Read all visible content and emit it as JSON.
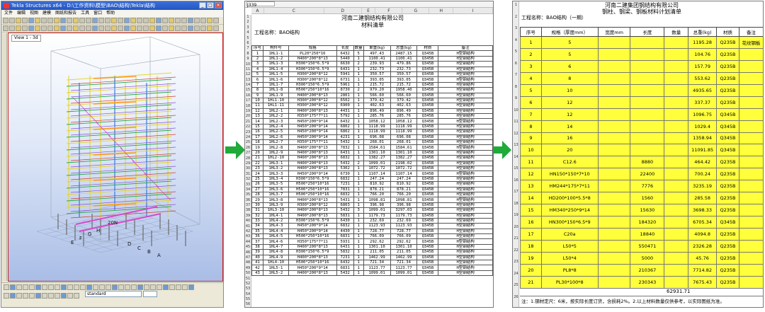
{
  "tekla": {
    "window_title": "Tekla Structures x64 - D:\\工作资料\\模型\\BAO\\结构\\Tekla\\结构",
    "menu": [
      "文件",
      "编辑",
      "视图",
      "建模",
      "图纸和报告",
      "工具",
      "窗口",
      "帮助"
    ],
    "view_label": "View 1 - 3d",
    "grid_labels": [
      "E",
      "F",
      "G",
      "H",
      "20N",
      "D",
      "C",
      "B",
      "A"
    ],
    "status_combo": "standard",
    "colors": {
      "titlebar": "#2456c2",
      "view_border": "#cc2222",
      "members": [
        "#e4d42a",
        "#d33a2a",
        "#2a6fd6",
        "#2aa84a",
        "#8a4fd0",
        "#d64ac8",
        "#ff8c1a"
      ]
    }
  },
  "arrows": {
    "color": "#1faa3a"
  },
  "sheet": {
    "name_box": "J339",
    "columns": [
      "A",
      "C",
      "D",
      "E",
      "F",
      "G",
      "H",
      "I"
    ],
    "title1": "河南二建钢结构有限公司",
    "title2": "材料清单",
    "title3": "工程名称：BAO结构",
    "headers": [
      "序号",
      "构件号",
      "规格",
      "长度",
      "数量",
      "单重(kg)",
      "总重(kg)",
      "材质",
      "备注"
    ],
    "rows": [
      [
        "1",
        "1HL1-1",
        "PL20*250*16",
        "6432",
        "5",
        "497.43",
        "2487.15",
        "Q345B",
        "H型钢结构"
      ],
      [
        "2",
        "1HL1-2",
        "H400*200*8*13",
        "5440",
        "1",
        "1100.41",
        "1100.41",
        "Q345B",
        "H型钢结构"
      ],
      [
        "3",
        "1HL1-3",
        "H300*150*6.5*9",
        "6630",
        "2",
        "239.93",
        "479.86",
        "Q345B",
        "H型钢结构"
      ],
      [
        "4",
        "1HL1-4",
        "H300*150*6.5*9",
        "6431",
        "1",
        "232.73",
        "232.73",
        "Q345B",
        "H型钢结构"
      ],
      [
        "5",
        "1HL1-5",
        "H300*200*8*12",
        "5941",
        "1",
        "350.57",
        "350.57",
        "Q345B",
        "H型钢结构"
      ],
      [
        "6",
        "1HL1-6",
        "H300*200*8*12",
        "6731",
        "1",
        "393.05",
        "393.05",
        "Q345B",
        "H型钢结构"
      ],
      [
        "7",
        "1HL1-7",
        "H300*150*6.5*9",
        "5961",
        "1",
        "215.72",
        "215.72",
        "Q345B",
        "H型钢结构"
      ],
      [
        "8",
        "1HL1-8",
        "H500*250*10*16",
        "8730",
        "2",
        "979.20",
        "1958.40",
        "Q345B",
        "H型钢结构"
      ],
      [
        "9",
        "1HL1-9",
        "H400*200*8*13",
        "2801",
        "1",
        "566.60",
        "566.60",
        "Q345B",
        "H型钢结构"
      ],
      [
        "10",
        "1HL1-10",
        "H300*200*8*12",
        "6502",
        "1",
        "379.42",
        "379.42",
        "Q345B",
        "H型钢结构"
      ],
      [
        "11",
        "1HL1-11",
        "H300*200*8*12",
        "6900",
        "1",
        "402.63",
        "402.63",
        "Q345B",
        "H型钢结构"
      ],
      [
        "12",
        "1HL2-1",
        "H400*200*8*13",
        "4431",
        "1",
        "896.49",
        "896.49",
        "Q345B",
        "H型钢结构"
      ],
      [
        "13",
        "1HL2-2",
        "H350*175*7*11",
        "5792",
        "1",
        "285.76",
        "285.76",
        "Q345B",
        "H型钢结构"
      ],
      [
        "14",
        "1HL2-3",
        "H450*200*9*14",
        "6432",
        "1",
        "1058.12",
        "1058.12",
        "Q345B",
        "H型钢结构"
      ],
      [
        "15",
        "1HL2-4",
        "H450*200*9*14",
        "6802",
        "1",
        "1118.99",
        "1118.99",
        "Q345B",
        "H型钢结构"
      ],
      [
        "16",
        "1HL2-5",
        "H450*200*9*14",
        "6802",
        "1",
        "1118.99",
        "1118.99",
        "Q345B",
        "H型钢结构"
      ],
      [
        "17",
        "1HL2-6",
        "H450*200*9*14",
        "4231",
        "1",
        "696.08",
        "696.08",
        "Q345B",
        "H型钢结构"
      ],
      [
        "18",
        "1HL2-7",
        "H350*175*7*11",
        "5432",
        "1",
        "268.01",
        "268.01",
        "Q345B",
        "H型钢结构"
      ],
      [
        "19",
        "1HL2-8",
        "H400*200*8*13",
        "7832",
        "1",
        "1584.61",
        "1584.61",
        "Q345B",
        "H型钢结构"
      ],
      [
        "20",
        "1HL2-9",
        "H400*200*8*13",
        "6431",
        "1",
        "1301.10",
        "1301.10",
        "Q345B",
        "H型钢结构"
      ],
      [
        "21",
        "1HL2-10",
        "H400*200*8*13",
        "6832",
        "1",
        "1382.27",
        "1382.27",
        "Q345B",
        "H型钢结构"
      ],
      [
        "22",
        "1HL3-1",
        "H400*200*8*13",
        "5432",
        "2",
        "1099.01",
        "2198.02",
        "Q345B",
        "H型钢结构"
      ],
      [
        "23",
        "1HL3-2",
        "H400*200*8*13",
        "5302",
        "1",
        "1072.72",
        "1072.72",
        "Q345B",
        "H型钢结构"
      ],
      [
        "24",
        "1HL3-3",
        "H450*200*9*14",
        "6730",
        "1",
        "1107.14",
        "1107.14",
        "Q345B",
        "H型钢结构"
      ],
      [
        "25",
        "1HL3-4",
        "H300*150*6.5*9",
        "6832",
        "1",
        "247.24",
        "247.24",
        "Q345B",
        "H型钢结构"
      ],
      [
        "26",
        "1HL3-5",
        "H500*250*10*16",
        "7231",
        "1",
        "810.92",
        "810.92",
        "Q345B",
        "H型钢结构"
      ],
      [
        "27",
        "1HL3-6",
        "H500*250*10*16",
        "7831",
        "1",
        "878.21",
        "878.21",
        "Q345B",
        "H型钢结构"
      ],
      [
        "28",
        "1HL3-7",
        "H500*250*10*16",
        "6832",
        "1",
        "766.20",
        "766.20",
        "Q345B",
        "H型钢结构"
      ],
      [
        "29",
        "1HL3-8",
        "H400*200*8*13",
        "5431",
        "1",
        "1098.81",
        "1098.81",
        "Q345B",
        "H型钢结构"
      ],
      [
        "30",
        "1HL3-9",
        "H300*200*8*12",
        "6803",
        "1",
        "396.98",
        "396.98",
        "Q345B",
        "H型钢结构"
      ],
      [
        "31",
        "1HL3-10",
        "H400*200*8*13",
        "5432",
        "3",
        "1099.01",
        "3297.03",
        "Q345B",
        "H型钢结构"
      ],
      [
        "32",
        "1HL4-1",
        "H400*200*8*13",
        "5831",
        "1",
        "1179.73",
        "1179.73",
        "Q345B",
        "H型钢结构"
      ],
      [
        "33",
        "1HL4-2",
        "H300*150*6.5*9",
        "6430",
        "1",
        "232.69",
        "232.69",
        "Q345B",
        "H型钢结构"
      ],
      [
        "34",
        "1HL4-3",
        "H450*200*9*14",
        "6832",
        "1",
        "1123.93",
        "1123.93",
        "Q345B",
        "H型钢结构"
      ],
      [
        "35",
        "1HL4-4",
        "H450*200*9*14",
        "4430",
        "1",
        "728.77",
        "728.77",
        "Q345B",
        "H型钢结构"
      ],
      [
        "36",
        "1HL4-5",
        "H500*250*10*16",
        "6831",
        "1",
        "766.09",
        "766.09",
        "Q345B",
        "H型钢结构"
      ],
      [
        "37",
        "1HL4-6",
        "H350*175*7*11",
        "5931",
        "1",
        "292.62",
        "292.62",
        "Q345B",
        "H型钢结构"
      ],
      [
        "38",
        "1HL4-7",
        "H400*200*8*13",
        "6431",
        "1",
        "1301.10",
        "1301.10",
        "Q345B",
        "H型钢结构"
      ],
      [
        "39",
        "1HL4-8",
        "H300*150*6.5*9",
        "5832",
        "1",
        "211.05",
        "211.05",
        "Q345B",
        "H型钢结构"
      ],
      [
        "40",
        "1HL4-9",
        "H400*200*8*13",
        "7231",
        "1",
        "1462.99",
        "1462.99",
        "Q345B",
        "H型钢结构"
      ],
      [
        "41",
        "1HL4-10",
        "H500*250*10*16",
        "6432",
        "1",
        "721.34",
        "721.34",
        "Q345B",
        "H型钢结构"
      ],
      [
        "42",
        "1HL5-1",
        "H450*200*9*14",
        "6831",
        "1",
        "1123.77",
        "1123.77",
        "Q345B",
        "H型钢结构"
      ],
      [
        "43",
        "1HL5-2",
        "H400*200*8*13",
        "5432",
        "1",
        "1099.01",
        "1099.01",
        "Q345B",
        "H型钢结构"
      ]
    ]
  },
  "summary": {
    "title1": "河南二建集团钢结构有限公司",
    "title2": "钢柱、钢梁、钢板材料计划清单",
    "project": "工程名称：BAO结构（一期）",
    "headers": [
      "序号",
      "规格（厚度mm）",
      "宽度mm",
      "长度",
      "数量",
      "总重(kg)",
      "材质",
      "备注"
    ],
    "rows": [
      {
        "no": "1",
        "spec": "5",
        "width": "",
        "length": "",
        "qty": "",
        "weight": "1195.28",
        "mat": "Q235B",
        "note": "花纹钢板"
      },
      {
        "no": "2",
        "spec": "5",
        "width": "",
        "length": "",
        "qty": "",
        "weight": "104.76",
        "mat": "Q235B",
        "note": ""
      },
      {
        "no": "3",
        "spec": "6",
        "width": "",
        "length": "",
        "qty": "",
        "weight": "157.79",
        "mat": "Q235B",
        "note": ""
      },
      {
        "no": "4",
        "spec": "8",
        "width": "",
        "length": "",
        "qty": "",
        "weight": "553.62",
        "mat": "Q235B",
        "note": ""
      },
      {
        "no": "5",
        "spec": "10",
        "width": "",
        "length": "",
        "qty": "",
        "weight": "4935.65",
        "mat": "Q235B",
        "note": ""
      },
      {
        "no": "6",
        "spec": "12",
        "width": "",
        "length": "",
        "qty": "",
        "weight": "337.37",
        "mat": "Q235B",
        "note": ""
      },
      {
        "no": "7",
        "spec": "12",
        "width": "",
        "length": "",
        "qty": "",
        "weight": "1096.75",
        "mat": "Q345B",
        "note": ""
      },
      {
        "no": "8",
        "spec": "14",
        "width": "",
        "length": "",
        "qty": "",
        "weight": "1029.4",
        "mat": "Q345B",
        "note": ""
      },
      {
        "no": "9",
        "spec": "16",
        "width": "",
        "length": "",
        "qty": "",
        "weight": "1358.94",
        "mat": "Q345B",
        "note": ""
      },
      {
        "no": "10",
        "spec": "20",
        "width": "",
        "length": "",
        "qty": "",
        "weight": "11091.85",
        "mat": "Q345B",
        "note": ""
      },
      {
        "no": "11",
        "spec": "C12.6",
        "width": "",
        "length": "8880",
        "qty": "",
        "weight": "464.42",
        "mat": "Q235B",
        "note": ""
      },
      {
        "no": "12",
        "spec": "HN150*150*7*10",
        "width": "",
        "length": "22400",
        "qty": "",
        "weight": "700.24",
        "mat": "Q235B",
        "note": ""
      },
      {
        "no": "13",
        "spec": "HM244*175*7*11",
        "width": "",
        "length": "7776",
        "qty": "",
        "weight": "3235.19",
        "mat": "Q235B",
        "note": ""
      },
      {
        "no": "14",
        "spec": "HD200*100*5.5*8",
        "width": "",
        "length": "1560",
        "qty": "",
        "weight": "285.58",
        "mat": "Q235B",
        "note": ""
      },
      {
        "no": "15",
        "spec": "HM340*250*9*14",
        "width": "",
        "length": "15630",
        "qty": "",
        "weight": "3698.33",
        "mat": "Q235B",
        "note": ""
      },
      {
        "no": "16",
        "spec": "HN300*150*6.5*9",
        "width": "",
        "length": "184320",
        "qty": "",
        "weight": "6705.34",
        "mat": "Q345B",
        "note": ""
      },
      {
        "no": "17",
        "spec": "C20a",
        "width": "",
        "length": "18840",
        "qty": "",
        "weight": "4094.8",
        "mat": "Q235B",
        "note": ""
      },
      {
        "no": "18",
        "spec": "L50*5",
        "width": "",
        "length": "550471",
        "qty": "",
        "weight": "2326.28",
        "mat": "Q235B",
        "note": ""
      },
      {
        "no": "19",
        "spec": "L50*4",
        "width": "",
        "length": "5000",
        "qty": "",
        "weight": "45.76",
        "mat": "Q235B",
        "note": ""
      },
      {
        "no": "20",
        "spec": "PL8*8",
        "width": "",
        "length": "210367",
        "qty": "",
        "weight": "7714.82",
        "mat": "Q235B",
        "note": ""
      },
      {
        "no": "21",
        "spec": "PL30*100*8",
        "width": "",
        "length": "230343",
        "qty": "",
        "weight": "7675.43",
        "mat": "Q235B",
        "note": ""
      }
    ],
    "total": "62931.71",
    "note": "注：1.钢材定尺：6米，按实际长度订货，含损耗2%。2.以上材料数量仅供参考，以实际图纸为准。",
    "row_color": "#ffff3b"
  }
}
